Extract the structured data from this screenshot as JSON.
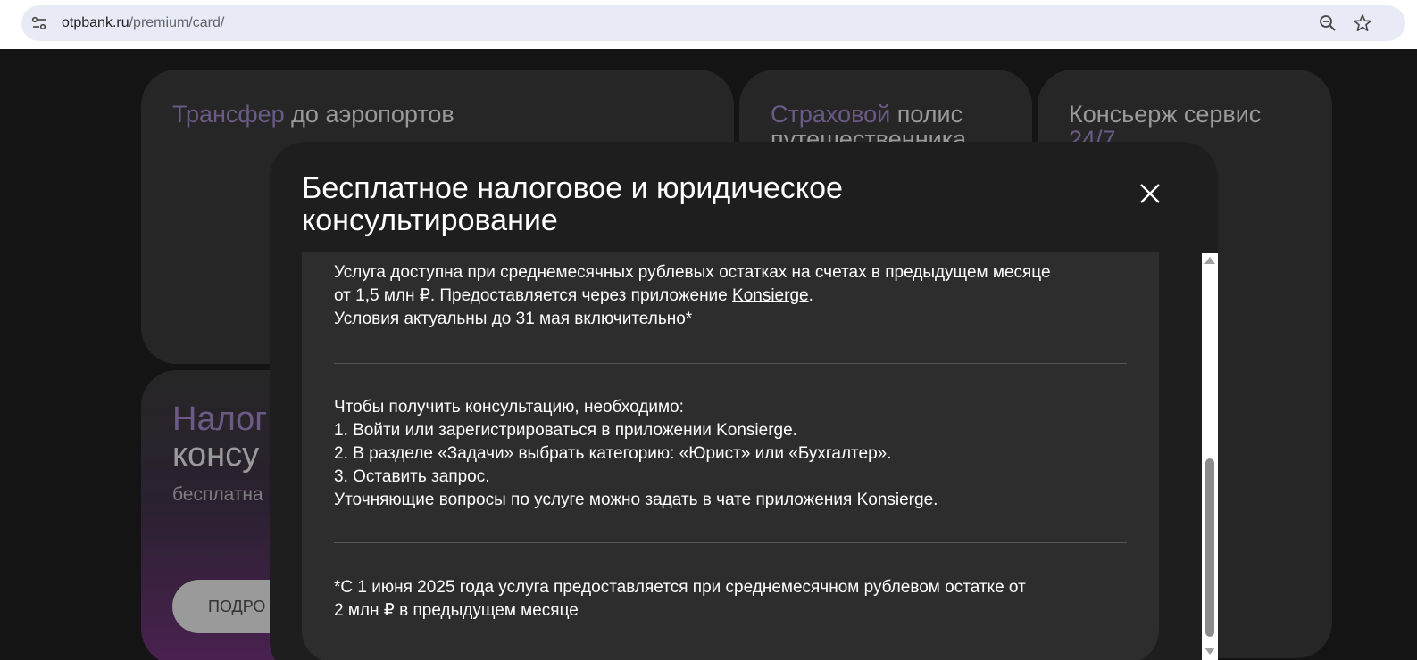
{
  "browser": {
    "url_host": "otpbank.ru",
    "url_path": "/premium/card/",
    "icons": [
      "tune-icon",
      "zoom-out-icon",
      "star-icon"
    ]
  },
  "background": {
    "cards": [
      {
        "accent": "Трансфер",
        "rest": " до аэропортов"
      },
      {
        "accent": "Страховой",
        "rest": " полис путешественника"
      },
      {
        "accent": "",
        "rest": "Консьерж сервис",
        "accent2": "24/7"
      }
    ],
    "promo": {
      "title_accent": "Налог",
      "title_rest": "консу",
      "subtitle": "бесплатна",
      "button": "ПОДРО"
    }
  },
  "modal": {
    "title": "Бесплатное налоговое и юридическое консультирование",
    "block1": {
      "line1": "Услуга доступна при среднемесячных рублевых остатках на счетах в предыдущем месяце",
      "line2_pre": "от 1,5 млн ₽. Предоставляется через приложение ",
      "link": "Konsierge",
      "line2_post": ".",
      "line3": "Условия актуальны до 31 мая включительно*"
    },
    "block2": {
      "lines": [
        "Чтобы получить консультацию, необходимо:",
        "1. Войти или зарегистрироваться в приложении Konsierge.",
        "2. В разделе «Задачи» выбрать категорию: «Юрист» или «Бухгалтер».",
        "3. Оставить запрос.",
        "Уточняющие вопросы по услуге можно задать в чате приложения Konsierge."
      ]
    },
    "block3": {
      "lines": [
        "*С 1 июня 2025 года услуга предоставляется при среднемесячном рублевом остатке от",
        "2 млн ₽ в предыдущем месяце"
      ]
    }
  }
}
